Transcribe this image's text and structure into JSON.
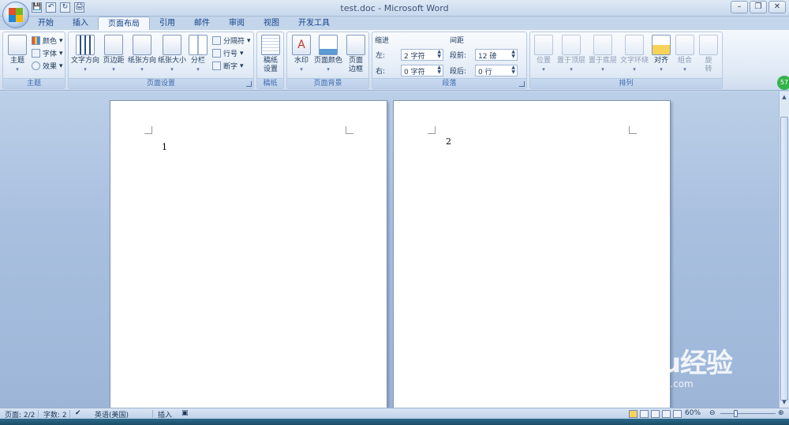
{
  "window": {
    "title": "test.doc - Microsoft Word",
    "controls": {
      "minimize": "–",
      "restore": "❐",
      "close": "✕"
    }
  },
  "qat": {
    "save": "💾",
    "undo": "↶",
    "redo": "↻",
    "print": "🖨"
  },
  "tabs": [
    {
      "label": "开始"
    },
    {
      "label": "插入"
    },
    {
      "label": "页面布局",
      "active": true
    },
    {
      "label": "引用"
    },
    {
      "label": "邮件"
    },
    {
      "label": "审阅"
    },
    {
      "label": "视图"
    },
    {
      "label": "开发工具"
    }
  ],
  "ribbon": {
    "theme": {
      "label": "主题",
      "big": "主题",
      "colors": "颜色",
      "fonts": "字体",
      "effects": "效果"
    },
    "page_setup": {
      "label": "页面设置",
      "text_direction": "文字方向",
      "margins": "页边距",
      "orientation": "纸张方向",
      "size": "纸张大小",
      "columns": "分栏",
      "breaks": "分隔符",
      "line_numbers": "行号",
      "hyphenation": "断字"
    },
    "manuscript": {
      "label": "稿纸",
      "button_line1": "稿纸",
      "button_line2": "设置"
    },
    "page_background": {
      "label": "页面背景",
      "watermark": "水印",
      "page_color": "页面颜色",
      "border_line1": "页面",
      "border_line2": "边框"
    },
    "paragraph": {
      "label": "段落",
      "indent_title": "缩进",
      "left_label": "左:",
      "left_value": "2 字符",
      "right_label": "右:",
      "right_value": "0 字符",
      "spacing_title": "间距",
      "before_label": "段前:",
      "before_value": "12 磅",
      "after_label": "段后:",
      "after_value": "0 行"
    },
    "arrange": {
      "label": "排列",
      "position": "位置",
      "bring_front": "置于顶层",
      "send_back": "置于底层",
      "wrap": "文字环绕",
      "align": "对齐",
      "group": "组合",
      "rotate_line1": "旋",
      "rotate_line2": "转"
    }
  },
  "document": {
    "page1_number": "1",
    "page2_number": "2"
  },
  "badge": "57",
  "watermark": {
    "line1": "Baidu经验",
    "line2": "jingyan.baidu.com"
  },
  "status": {
    "page": "页面: 2/2",
    "words": "字数: 2",
    "language": "英语(美国)",
    "mode": "插入",
    "zoom": "60%",
    "zoom_out": "⊖",
    "zoom_in": "⊕"
  }
}
